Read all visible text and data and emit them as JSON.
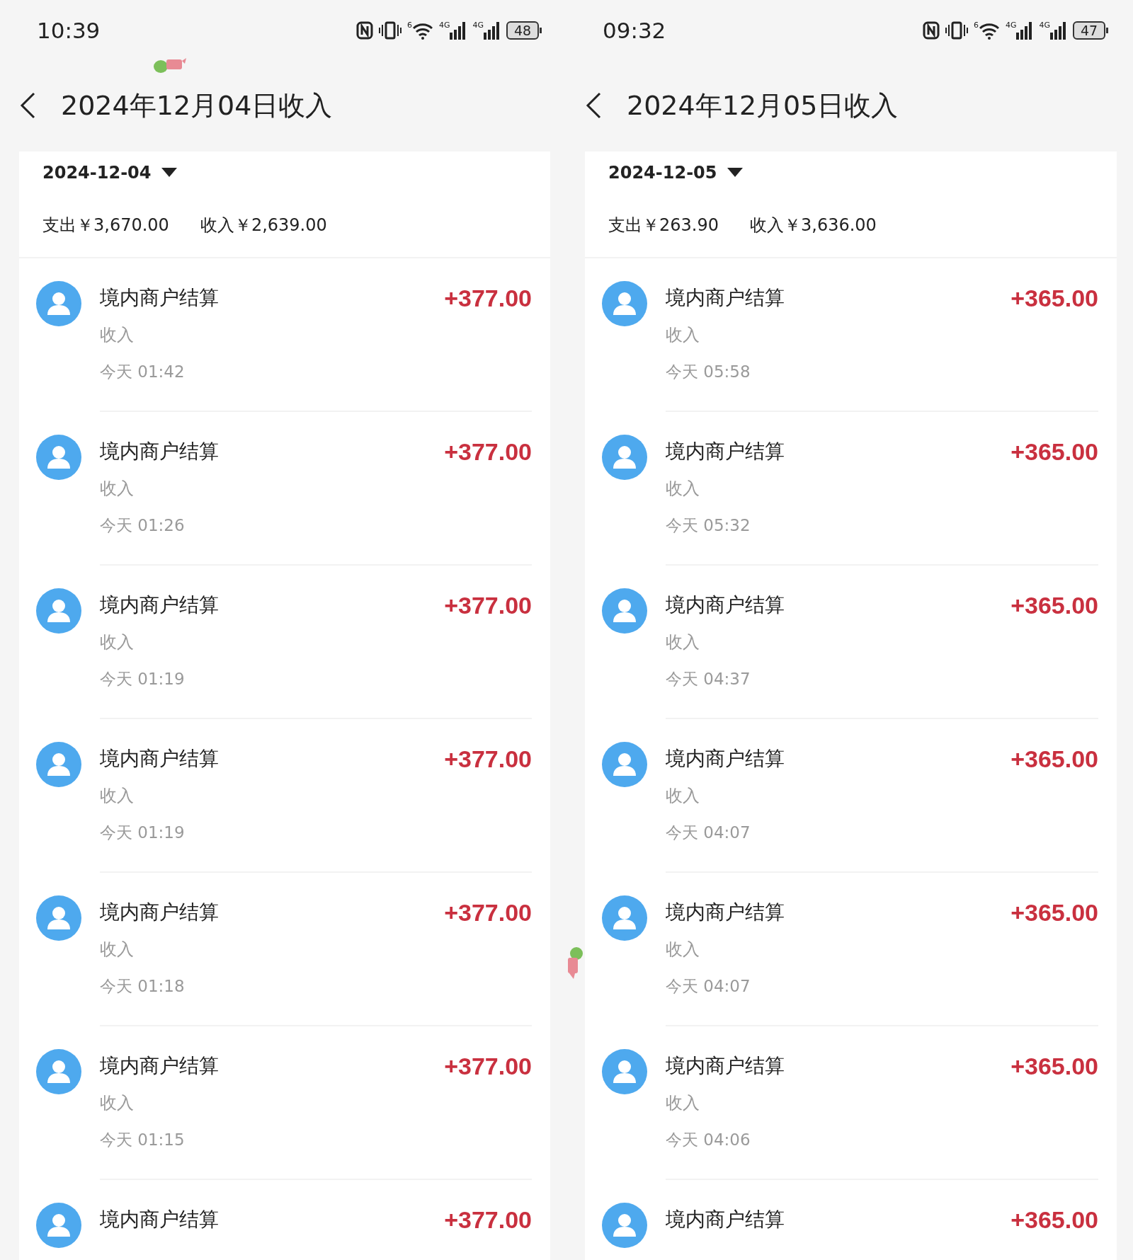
{
  "panels": [
    {
      "status_bar": {
        "time": "10:39",
        "network_badge": "6",
        "sim_1": "4G",
        "sim_2": "4G",
        "battery": "48"
      },
      "title": "2024年12月04日收入",
      "date": "2024-12-04",
      "summary": {
        "expense": "支出￥3,670.00",
        "income": "收入￥2,639.00"
      },
      "rows": [
        {
          "name": "境内商户结算",
          "type": "收入",
          "time": "今天 01:42",
          "amount": "+377.00"
        },
        {
          "name": "境内商户结算",
          "type": "收入",
          "time": "今天 01:26",
          "amount": "+377.00"
        },
        {
          "name": "境内商户结算",
          "type": "收入",
          "time": "今天 01:19",
          "amount": "+377.00"
        },
        {
          "name": "境内商户结算",
          "type": "收入",
          "time": "今天 01:19",
          "amount": "+377.00"
        },
        {
          "name": "境内商户结算",
          "type": "收入",
          "time": "今天 01:18",
          "amount": "+377.00"
        },
        {
          "name": "境内商户结算",
          "type": "收入",
          "time": "今天 01:15",
          "amount": "+377.00"
        },
        {
          "name": "境内商户结算",
          "amount": "+377.00"
        }
      ]
    },
    {
      "status_bar": {
        "time": "09:32",
        "network_badge": "6",
        "sim_1": "4G",
        "sim_2": "4G",
        "battery": "47"
      },
      "title": "2024年12月05日收入",
      "date": "2024-12-05",
      "summary": {
        "expense": "支出￥263.90",
        "income": "收入￥3,636.00"
      },
      "rows": [
        {
          "name": "境内商户结算",
          "type": "收入",
          "time": "今天 05:58",
          "amount": "+365.00"
        },
        {
          "name": "境内商户结算",
          "type": "收入",
          "time": "今天 05:32",
          "amount": "+365.00"
        },
        {
          "name": "境内商户结算",
          "type": "收入",
          "time": "今天 04:37",
          "amount": "+365.00"
        },
        {
          "name": "境内商户结算",
          "type": "收入",
          "time": "今天 04:07",
          "amount": "+365.00"
        },
        {
          "name": "境内商户结算",
          "type": "收入",
          "time": "今天 04:07",
          "amount": "+365.00"
        },
        {
          "name": "境内商户结算",
          "type": "收入",
          "time": "今天 04:06",
          "amount": "+365.00"
        },
        {
          "name": "境内商户结算",
          "amount": "+365.00"
        }
      ]
    }
  ]
}
